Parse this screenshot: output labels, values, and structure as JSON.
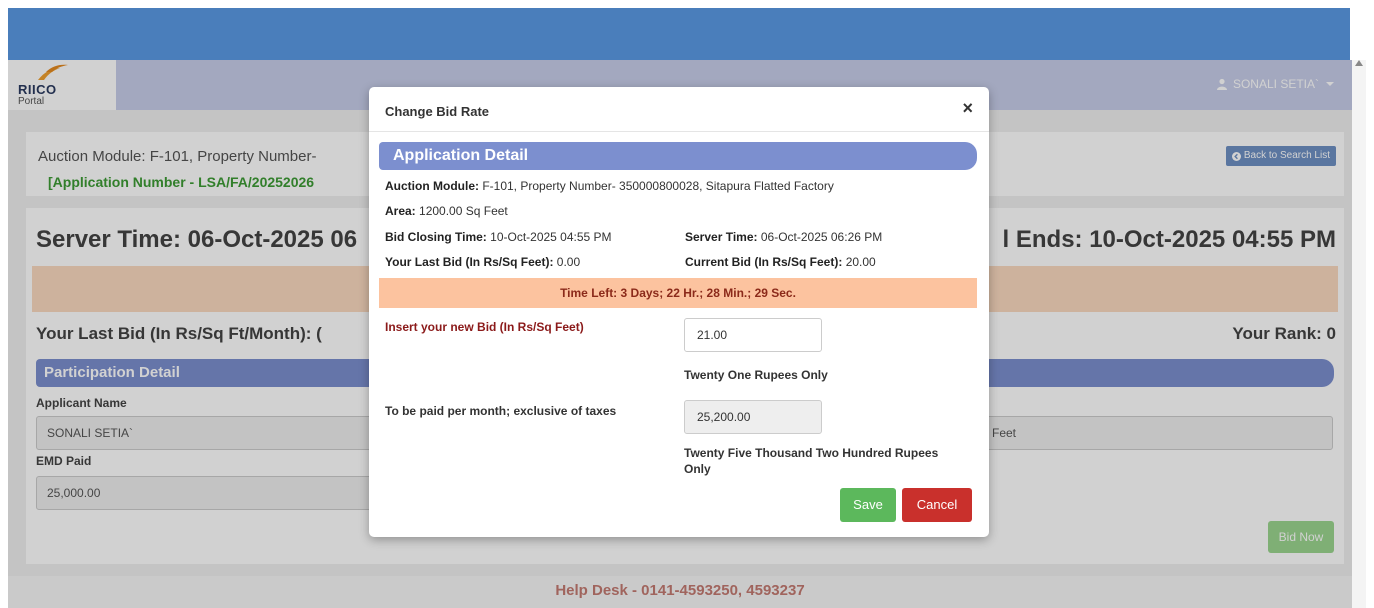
{
  "navbar": {
    "logo_text": "RIICO",
    "logo_subtext": "Portal",
    "user_name": "SONALI SETIA`"
  },
  "header_card": {
    "auction_title": "Auction Module: F-101, Property Number-",
    "application_number": "[Application Number - LSA/FA/20252026",
    "back_button": "Back to Search List"
  },
  "bid_card": {
    "server_time": "Server Time: 06-Oct-2025 06",
    "bid_ends": "l Ends: 10-Oct-2025 04:55 PM",
    "last_bid": "Your Last Bid (In Rs/Sq Ft/Month): (",
    "rank": "Your Rank: 0",
    "participation_header": "Participation Detail",
    "applicant_name_label": "Applicant Name",
    "applicant_name_value": "SONALI SETIA`",
    "area_value_partial": "Feet",
    "emd_paid_label": "EMD Paid",
    "emd_paid_value": "25,000.00",
    "bid_now_button": "Bid Now"
  },
  "footer": {
    "help_desk": "Help Desk - 0141-4593250, 4593237"
  },
  "modal": {
    "title": "Change Bid Rate",
    "close_symbol": "×",
    "section_header": "Application Detail",
    "auction_module_label": "Auction Module:",
    "auction_module_value": "F-101, Property Number- 350000800028, Sitapura Flatted Factory",
    "area_label": "Area:",
    "area_value": "1200.00 Sq Feet",
    "bid_closing_label": "Bid Closing Time:",
    "bid_closing_value": "10-Oct-2025 04:55 PM",
    "server_time_label": "Server Time:",
    "server_time_value": "06-Oct-2025 06:26 PM",
    "last_bid_label": "Your Last Bid (In Rs/Sq Feet):",
    "last_bid_value": "0.00",
    "current_bid_label": "Current Bid (In Rs/Sq Feet):",
    "current_bid_value": "20.00",
    "time_left": "Time Left: 3 Days; 22 Hr.; 28 Min.; 29 Sec.",
    "insert_bid_label": "Insert your new Bid (In Rs/Sq Feet)",
    "new_bid_value": "21.00",
    "new_bid_words": "Twenty One Rupees Only",
    "per_month_label": "To be paid per month; exclusive of taxes",
    "per_month_value": "25,200.00",
    "per_month_words_line1": "Twenty Five Thousand Two Hundred Rupees",
    "per_month_words_line2": "Only",
    "save_button": "Save",
    "cancel_button": "Cancel"
  },
  "colors": {
    "top_band": "#4a7ebb",
    "navbar": "#c7cde9",
    "section_header": "#7c8fcf",
    "timer_band": "#fcc39f",
    "save": "#5cb85c",
    "cancel": "#c9302c",
    "application_number": "#3d9b35"
  }
}
